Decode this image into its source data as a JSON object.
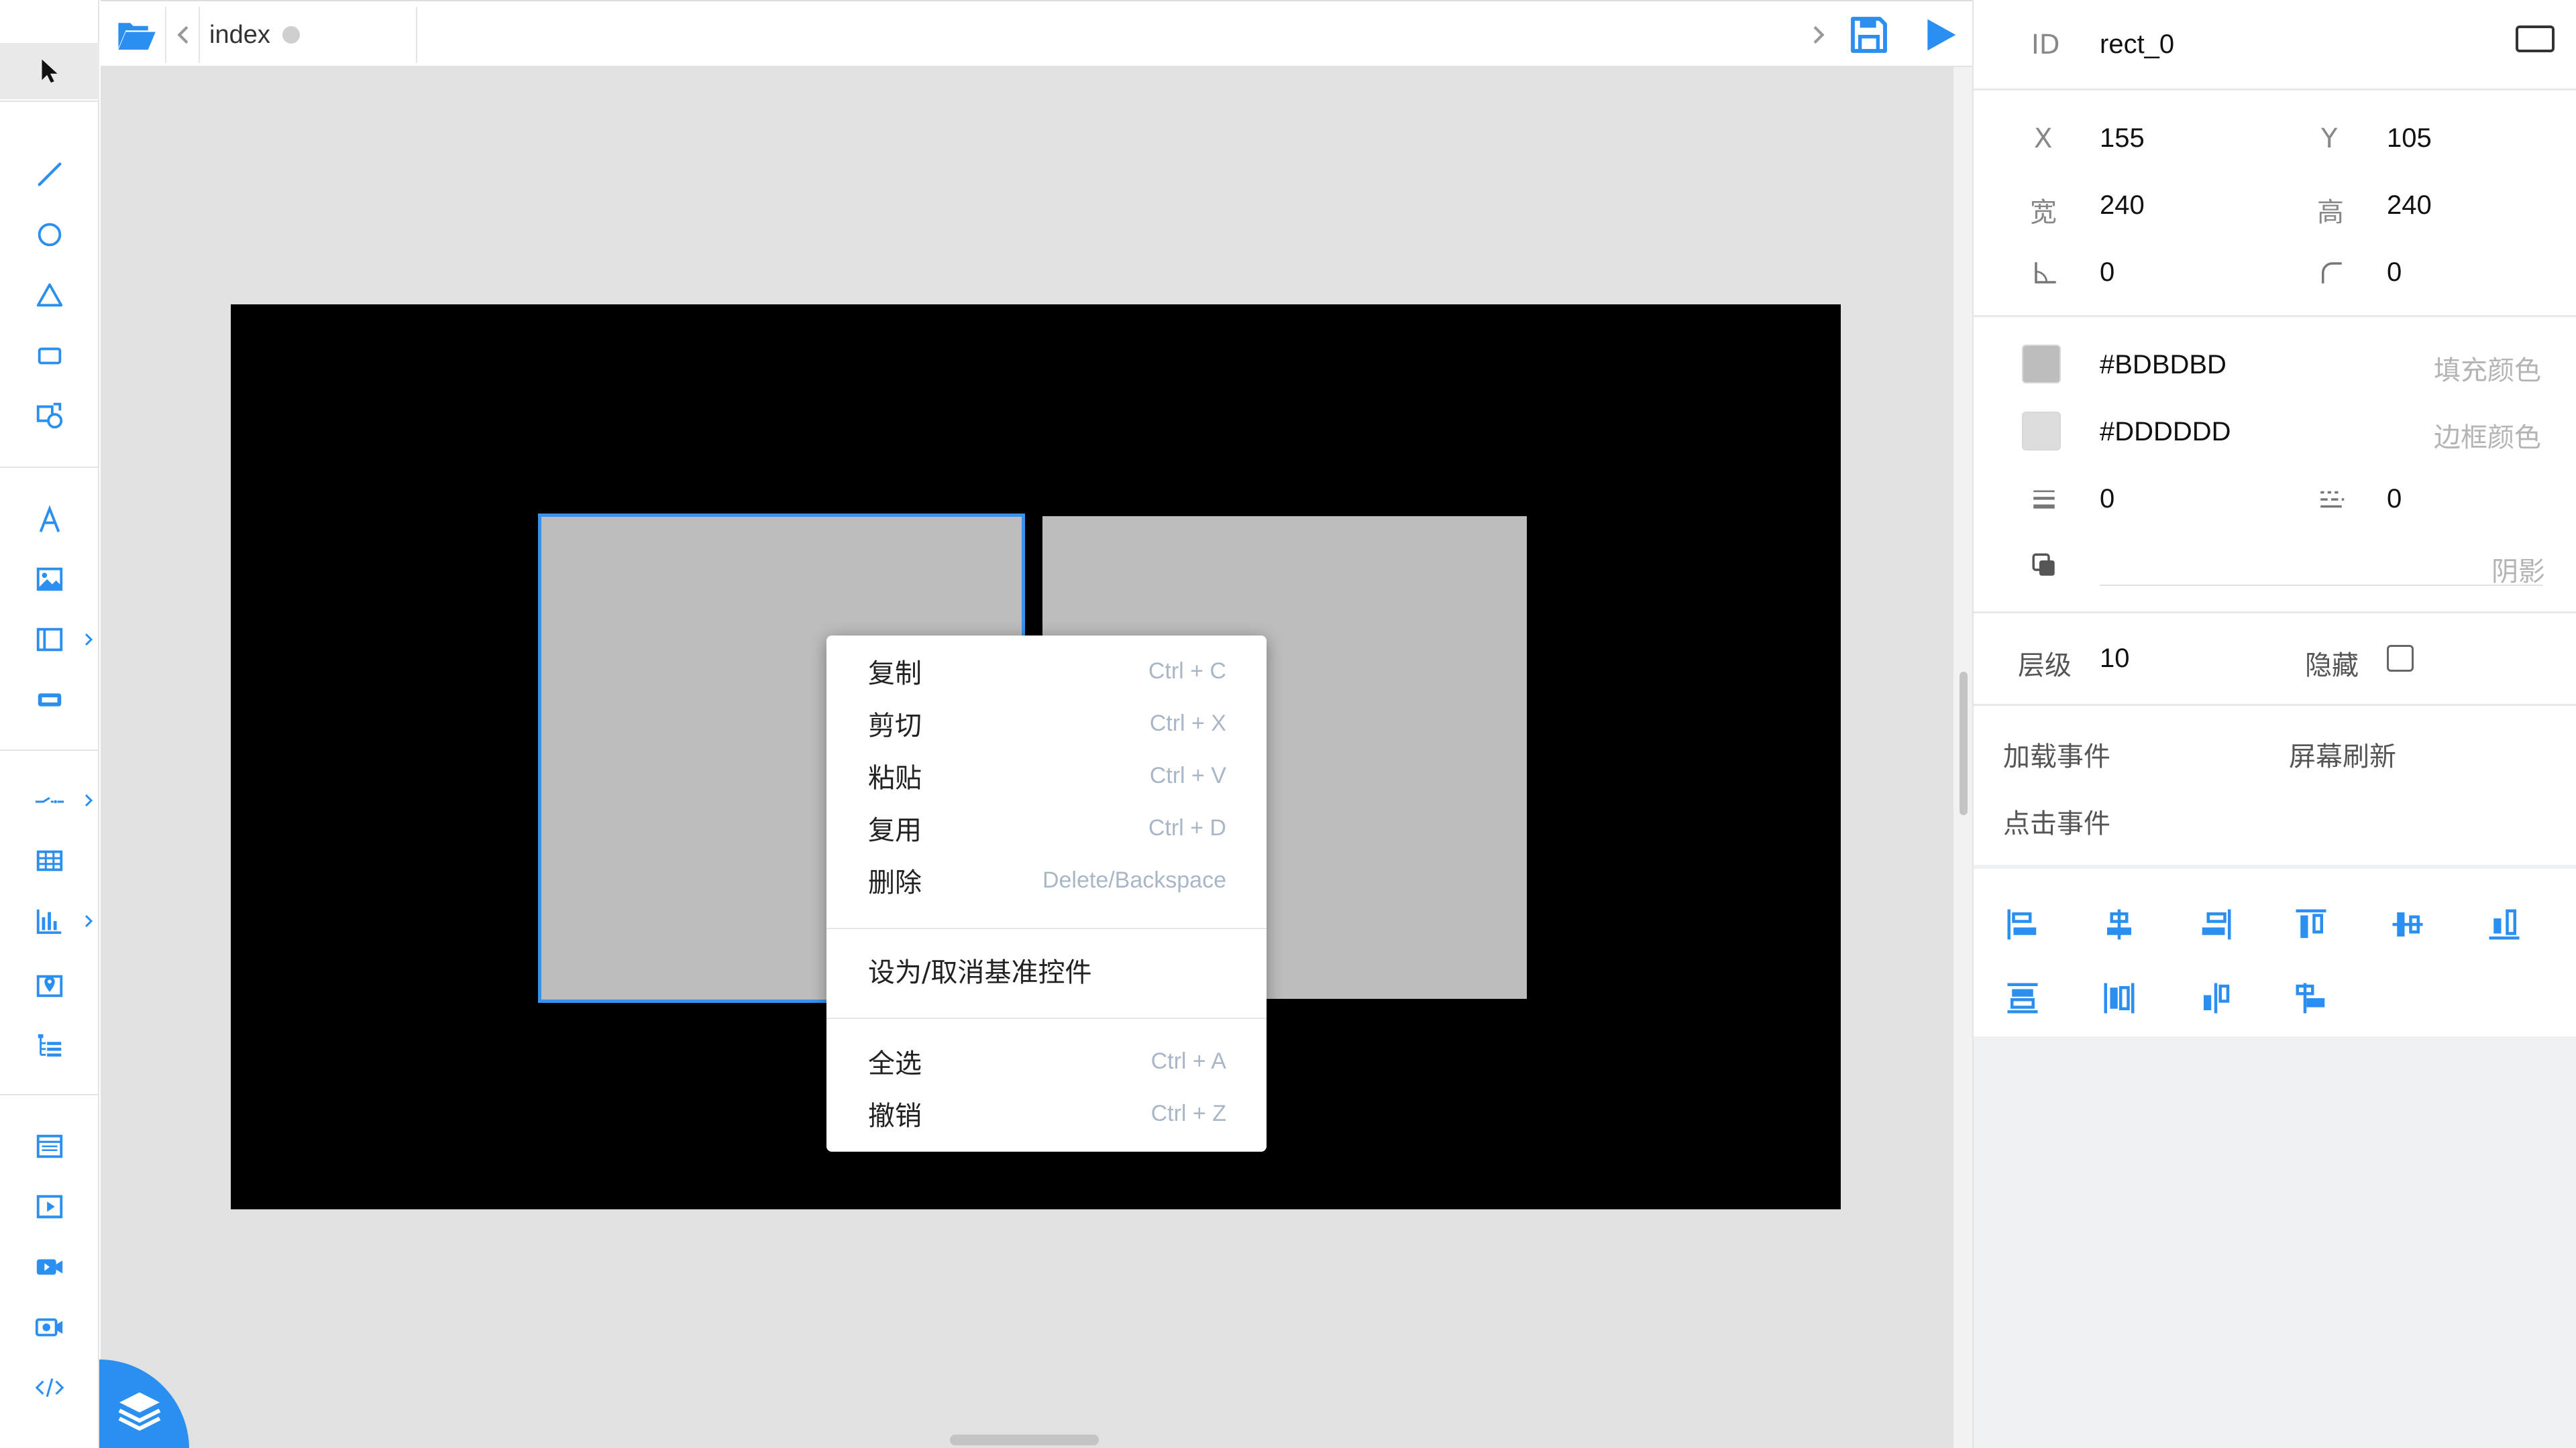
{
  "toolbar": {
    "tabs": [
      {
        "label": "index"
      }
    ]
  },
  "context_menu": {
    "items": [
      {
        "label": "复制",
        "shortcut": "Ctrl + C"
      },
      {
        "label": "剪切",
        "shortcut": "Ctrl + X"
      },
      {
        "label": "粘贴",
        "shortcut": "Ctrl + V"
      },
      {
        "label": "复用",
        "shortcut": "Ctrl + D"
      },
      {
        "label": "删除",
        "shortcut": "Delete/Backspace"
      },
      {
        "label": "设为/取消基准控件",
        "shortcut": ""
      },
      {
        "label": "全选",
        "shortcut": "Ctrl + A"
      },
      {
        "label": "撤销",
        "shortcut": "Ctrl + Z"
      }
    ]
  },
  "properties": {
    "id_label": "ID",
    "id_value": "rect_0",
    "x_label": "X",
    "x_value": "155",
    "y_label": "Y",
    "y_value": "105",
    "width_label": "宽",
    "width_value": "240",
    "height_label": "高",
    "height_value": "240",
    "angle_value": "0",
    "radius_value": "0",
    "fill_color": "#BDBDBD",
    "fill_hint": "填充颜色",
    "border_color": "#DDDDDD",
    "border_hint": "边框颜色",
    "border_width_value": "0",
    "border_dash_value": "0",
    "shadow_hint": "阴影",
    "layer_label": "层级",
    "layer_value": "10",
    "hidden_label": "隐藏",
    "events": {
      "load": "加载事件",
      "refresh": "屏幕刷新",
      "click": "点击事件"
    }
  },
  "colors": {
    "accent": "#2A8FF0",
    "selection": "#3A93EA",
    "stage": "#000000",
    "shape_fill": "#BDBDBD"
  }
}
